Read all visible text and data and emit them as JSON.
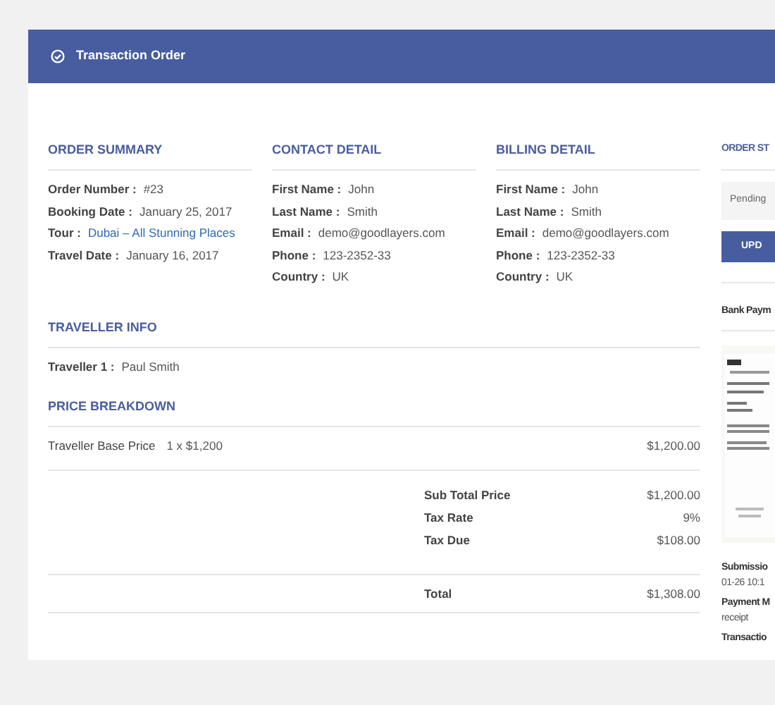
{
  "header": {
    "title": "Transaction Order"
  },
  "columns": [
    {
      "title": "ORDER SUMMARY",
      "rows": [
        {
          "label": "Order Number :",
          "value": "#23",
          "kind": "text"
        },
        {
          "label": "Booking Date :",
          "value": "January 25, 2017",
          "kind": "text"
        },
        {
          "label": "Tour :",
          "value": "Dubai – All Stunning Places",
          "kind": "link"
        },
        {
          "label": "Travel Date :",
          "value": "January 16, 2017",
          "kind": "text"
        }
      ]
    },
    {
      "title": "CONTACT DETAIL",
      "rows": [
        {
          "label": "First Name :",
          "value": "John",
          "kind": "text"
        },
        {
          "label": "Last Name :",
          "value": "Smith",
          "kind": "text"
        },
        {
          "label": "Email :",
          "value": "demo@goodlayers.com",
          "kind": "text"
        },
        {
          "label": "Phone :",
          "value": "123-2352-33",
          "kind": "text"
        },
        {
          "label": "Country :",
          "value": "UK",
          "kind": "text"
        }
      ]
    },
    {
      "title": "BILLING DETAIL",
      "rows": [
        {
          "label": "First Name :",
          "value": "John",
          "kind": "text"
        },
        {
          "label": "Last Name :",
          "value": "Smith",
          "kind": "text"
        },
        {
          "label": "Email :",
          "value": "demo@goodlayers.com",
          "kind": "text"
        },
        {
          "label": "Phone :",
          "value": "123-2352-33",
          "kind": "text"
        },
        {
          "label": "Country :",
          "value": "UK",
          "kind": "text"
        }
      ]
    }
  ],
  "traveller_info": {
    "title": "TRAVELLER INFO",
    "rows": [
      {
        "label": "Traveller 1 :",
        "value": "Paul Smith"
      }
    ]
  },
  "price_breakdown": {
    "title": "PRICE BREAKDOWN",
    "items": [
      {
        "label": "Traveller Base Price",
        "detail": "1 x $1,200",
        "amount": "$1,200.00"
      }
    ],
    "summary": [
      {
        "label": "Sub Total Price",
        "value": "$1,200.00"
      },
      {
        "label": "Tax Rate",
        "value": "9%"
      },
      {
        "label": "Tax Due",
        "value": "$108.00"
      }
    ],
    "total": {
      "label": "Total",
      "value": "$1,308.00"
    }
  },
  "order_status": {
    "title": "ORDER ST",
    "select_value": "Pending",
    "button": "UPD"
  },
  "bank_payment": {
    "title": "Bank Paym",
    "details": [
      {
        "label": "Submissio",
        "value": "01-26 10:1"
      },
      {
        "label": "Payment M",
        "value": "receipt"
      },
      {
        "label": "Transactio"
      }
    ]
  }
}
